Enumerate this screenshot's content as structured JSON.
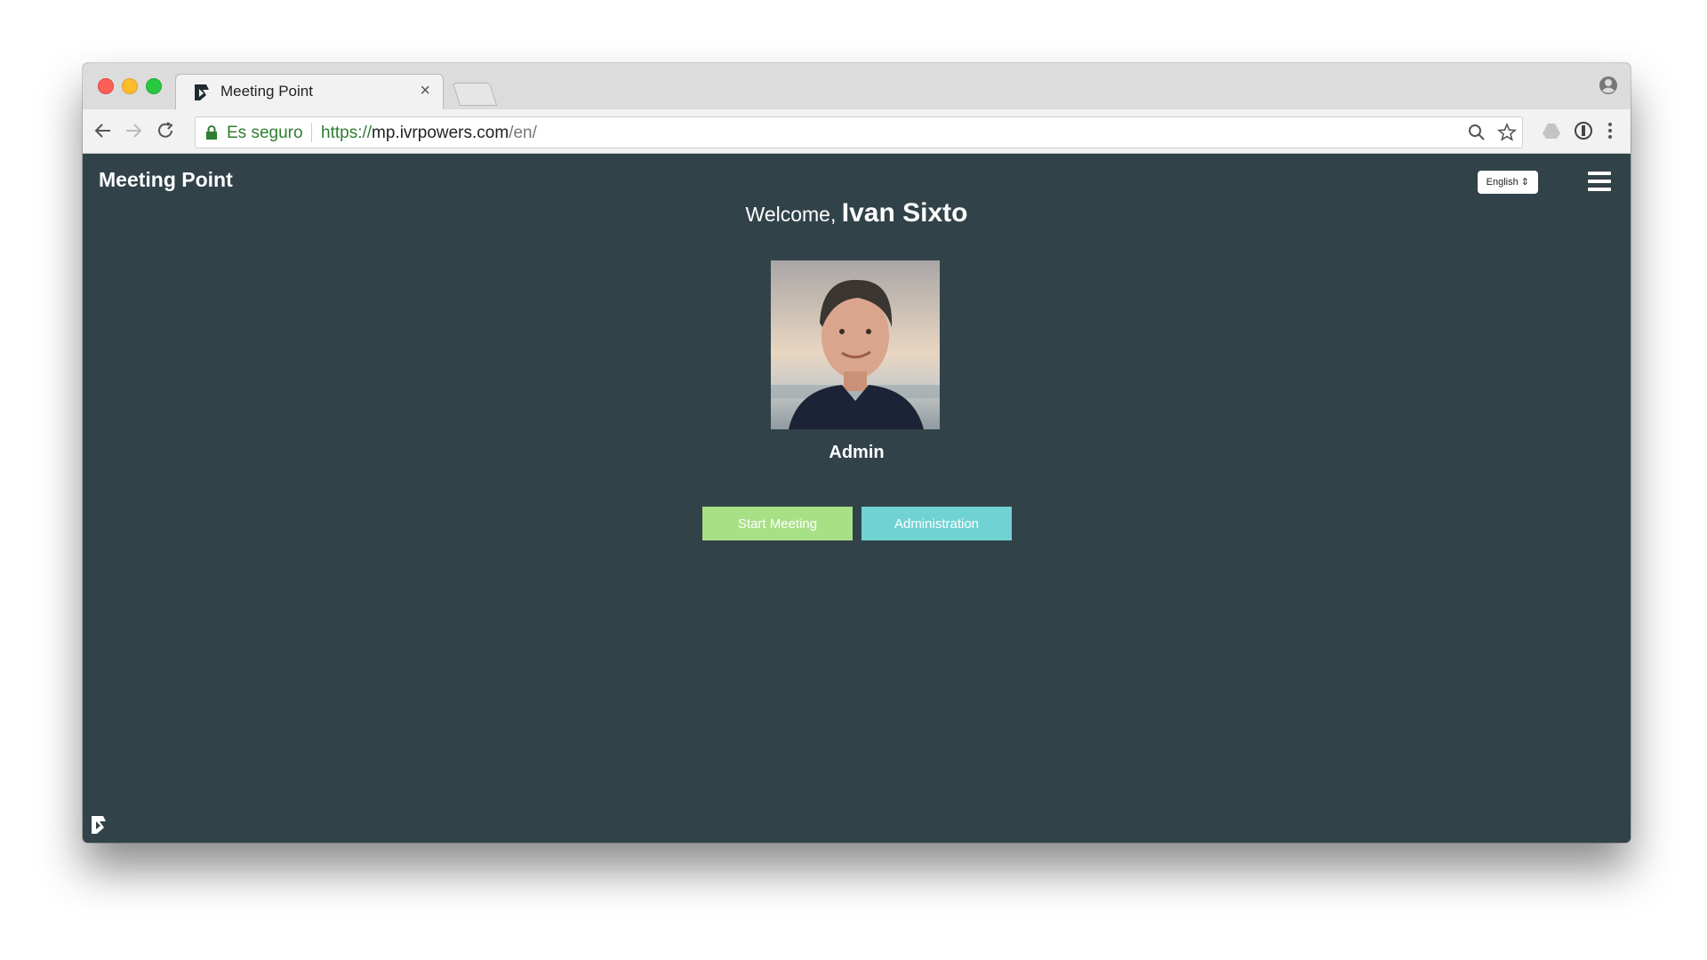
{
  "browser": {
    "tab_title": "Meeting Point",
    "tab_close": "×",
    "security_label": "Es seguro",
    "url_scheme": "https://",
    "url_host": "mp.ivrpowers.com",
    "url_path": "/en/",
    "icons": [
      "back-icon",
      "forward-icon",
      "reload-icon",
      "lock-icon",
      "zoom-icon",
      "star-icon",
      "drive-icon",
      "extension-icon",
      "menu-icon",
      "profile-icon"
    ]
  },
  "app": {
    "brand": "Meeting Point",
    "language_select": "English ⇕",
    "welcome_prefix": "Welcome, ",
    "user_name": "Ivan Sixto",
    "role": "Admin",
    "buttons": {
      "start_meeting": "Start Meeting",
      "administration": "Administration"
    },
    "colors": {
      "background": "#324249",
      "start_meeting": "#a8e086",
      "administration": "#71d2d4"
    }
  }
}
